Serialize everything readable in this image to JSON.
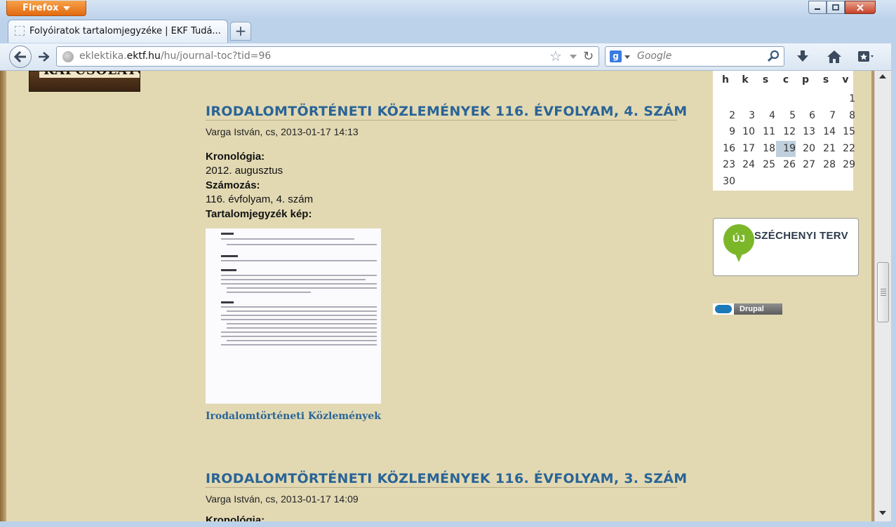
{
  "browser": {
    "app_menu_label": "Firefox",
    "tab_title": "Folyóiratok tartalomjegyzéke | EKF Tudá...",
    "new_tab_label": "+",
    "url_prefix": "eklektika.",
    "url_domain": "ektf.hu",
    "url_path": "/hu/journal-toc?tid=96",
    "search_engine_letter": "g",
    "search_placeholder": "Google"
  },
  "logo_text": "KAPCSOLATOK",
  "articles": [
    {
      "title": "IRODALOMTÖRTÉNETI KÖZLEMÉNYEK 116. ÉVFOLYAM, 4. SZÁM",
      "meta": "Varga István, cs, 2013-01-17 14:13",
      "chronology_label": "Kronológia:",
      "chronology_value": "2012. augusztus",
      "numbering_label": "Számozás:",
      "numbering_value": "116. évfolyam, 4. szám",
      "toc_image_label": "Tartalomjegyzék kép:",
      "journal_link": "Irodalomtörténeti Közlemények"
    },
    {
      "title": "IRODALOMTÖRTÉNETI KÖZLEMÉNYEK 116. ÉVFOLYAM, 3. SZÁM",
      "meta": "Varga István, cs, 2013-01-17 14:09",
      "chronology_label": "Kronológia:"
    }
  ],
  "calendar": {
    "weekdays": [
      "h",
      "k",
      "s",
      "c",
      "p",
      "s",
      "v"
    ],
    "rows": [
      [
        "",
        "",
        "",
        "",
        "",
        "",
        "1"
      ],
      [
        "2",
        "3",
        "4",
        "5",
        "6",
        "7",
        "8"
      ],
      [
        "9",
        "10",
        "11",
        "12",
        "13",
        "14",
        "15"
      ],
      [
        "16",
        "17",
        "18",
        "19",
        "20",
        "21",
        "22"
      ],
      [
        "23",
        "24",
        "25",
        "26",
        "27",
        "28",
        "29"
      ],
      [
        "30",
        "",
        "",
        "",
        "",
        "",
        ""
      ]
    ],
    "highlighted_day": "19"
  },
  "szechenyi": {
    "pin_text": "ÚJ",
    "label": "SZÉCHENYI TERV"
  },
  "drupal_badge": "Drupal"
}
